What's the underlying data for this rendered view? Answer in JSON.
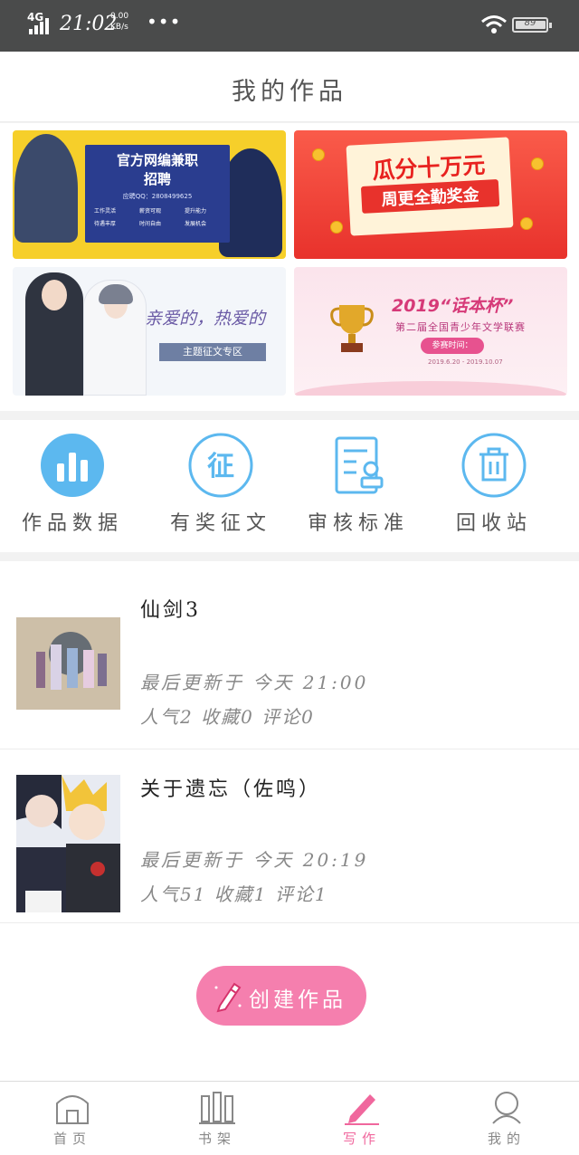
{
  "status_bar": {
    "network": "4G",
    "time": "21:02",
    "speed_value": "0.00",
    "speed_unit": "KB/s",
    "more": "•••",
    "battery": "89"
  },
  "header": {
    "title": "我的作品"
  },
  "banners": [
    {
      "title": "官方网编兼职",
      "subtitle": "招聘",
      "detail": "应聘QQ：2808499625",
      "chips": [
        "工作灵活",
        "薪资可观",
        "提升能力",
        "待遇丰厚",
        "时间自由",
        "发展机会"
      ]
    },
    {
      "title": "瓜分十万元",
      "subtitle": "周更全勤奖金",
      "detail": ""
    },
    {
      "title": "亲爱的，热爱的",
      "subtitle": "主题征文专区"
    },
    {
      "title": "2019“话本杯”",
      "subtitle": "第二届全国青少年文学联赛",
      "tag": "参赛时间：",
      "date": "2019.6.20 - 2019.10.07"
    }
  ],
  "quick_menu": [
    {
      "label": "作品数据",
      "icon": "bar-chart-icon"
    },
    {
      "label": "有奖征文",
      "icon": "contest-badge-icon"
    },
    {
      "label": "审核标准",
      "icon": "review-standard-icon"
    },
    {
      "label": "回收站",
      "icon": "trash-icon"
    }
  ],
  "works": [
    {
      "title": "仙剑3",
      "updated": "最后更新于 今天 21:00",
      "stats": "人气2 收藏0 评论0"
    },
    {
      "title": "关于遗忘（佐鸣）",
      "updated": "最后更新于 今天 20:19",
      "stats": "人气51 收藏1 评论1"
    }
  ],
  "create_button": {
    "label": "创建作品"
  },
  "tabs": [
    {
      "label": "首页",
      "icon": "home-icon"
    },
    {
      "label": "书架",
      "icon": "bookshelf-icon"
    },
    {
      "label": "写作",
      "icon": "write-icon",
      "active": true
    },
    {
      "label": "我的",
      "icon": "profile-icon"
    }
  ],
  "colors": {
    "accent": "#f0679d",
    "icon_blue": "#5cb8ef",
    "button_pink": "#f57fae",
    "status_bar": "#4a4b4b"
  }
}
